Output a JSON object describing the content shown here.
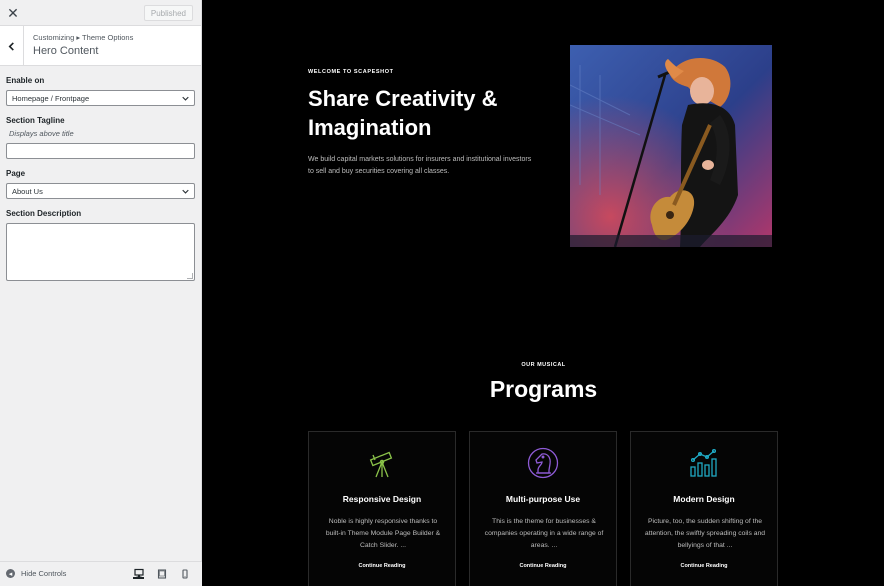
{
  "sidebar": {
    "close_glyph": "✕",
    "publish_label": "Published",
    "breadcrumb": "Customizing ▸ Theme Options",
    "section_title": "Hero Content",
    "controls": {
      "enable_on_label": "Enable on",
      "enable_on_value": "Homepage / Frontpage",
      "tagline_label": "Section Tagline",
      "tagline_desc": "Displays above title",
      "tagline_value": "",
      "page_label": "Page",
      "page_value": "About Us",
      "description_label": "Section Description",
      "description_value": ""
    },
    "footer": {
      "hide_controls_label": "Hide Controls",
      "hide_icon_glyph": "◂",
      "active_device": "desktop"
    }
  },
  "preview": {
    "hero": {
      "kicker": "WELCOME TO SCAPESHOT",
      "title": "Share Creativity & Imagination",
      "text": "We build capital markets solutions for insurers and institutional investors to sell and buy securities covering all classes."
    },
    "programs": {
      "kicker": "OUR MUSICAL",
      "title": "Programs",
      "cards": [
        {
          "icon": "telescope-icon",
          "icon_color": "#8bc34a",
          "title": "Responsive Design",
          "desc": "Noble is highly responsive thanks to built-in Theme Module Page Builder & Catch Slider. ...",
          "more": "Continue Reading"
        },
        {
          "icon": "chess-knight-icon",
          "icon_color": "#8e5bd6",
          "title": "Multi-purpose Use",
          "desc": "This is the theme for businesses & companies operating in a wide range of areas. ...",
          "more": "Continue Reading"
        },
        {
          "icon": "bar-chart-icon",
          "icon_color": "#1fa9c4",
          "title": "Modern Design",
          "desc": "Picture, too, the sudden shifting of the attention, the swiftly spreading coils and bellyings of that ...",
          "more": "Continue Reading"
        }
      ]
    }
  }
}
